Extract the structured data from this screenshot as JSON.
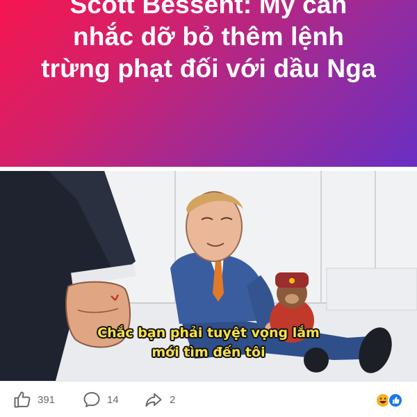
{
  "headline": {
    "lines": [
      "Scott Bessent: Mỹ cân",
      "nhắc dỡ bỏ thêm lệnh",
      "trừng phạt đối với dầu Nga"
    ]
  },
  "illustration": {
    "subtitle_line1": "Chắc bạn phải tuyệt vọng lắm",
    "subtitle_line2": "mới tìm đến tôi"
  },
  "actions": {
    "like_count": "391",
    "comment_count": "14",
    "share_count": "2",
    "like_icon": "thumbs-up-icon",
    "comment_icon": "comment-bubble-icon",
    "share_icon": "share-arrow-icon"
  },
  "reactions": [
    "haha-emoji-icon",
    "like-reaction-icon"
  ],
  "colors": {
    "banner_start": "#f5164f",
    "banner_end": "#6a2ec2",
    "subtitle": "#f7e04a",
    "action_text": "#65676b",
    "like_blue": "#1877f2"
  }
}
